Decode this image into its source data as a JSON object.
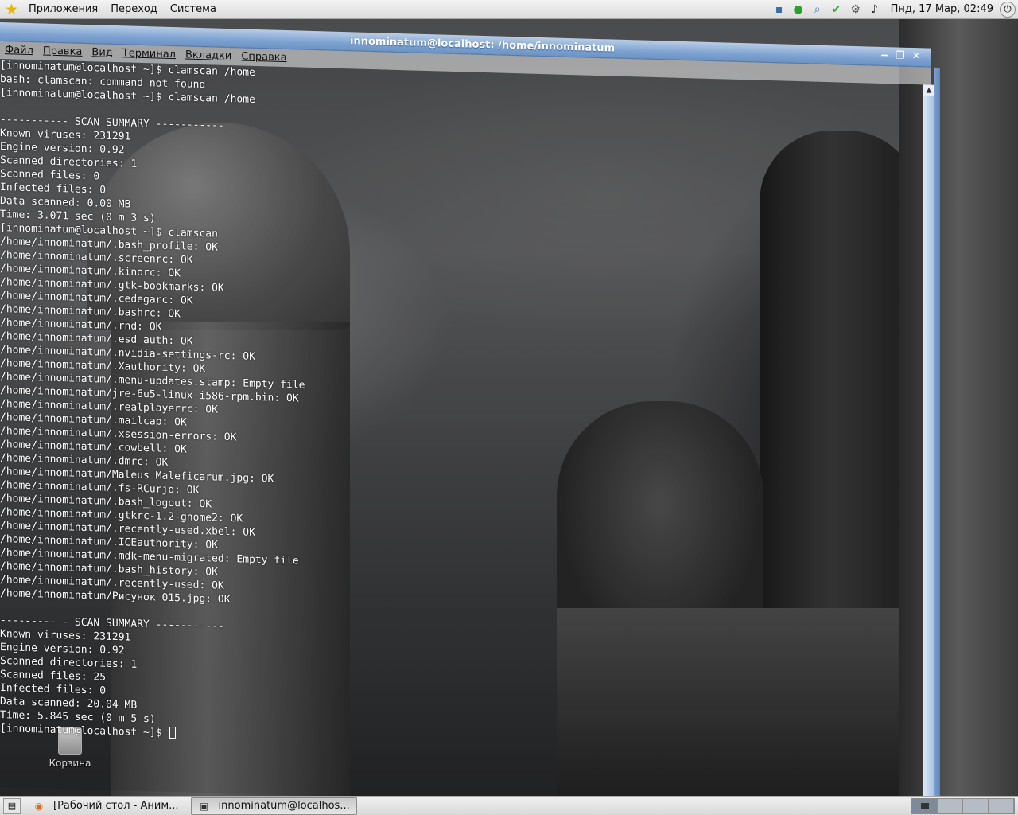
{
  "top_panel": {
    "menus": [
      "Приложения",
      "Переход",
      "Система"
    ],
    "clock": "Пнд, 17 Мар, 02:49",
    "tray_icons": [
      "network-icon",
      "green-status-icon",
      "search-icon",
      "update-check-icon",
      "network-tools-icon",
      "volume-icon"
    ]
  },
  "desktop": {
    "trash_label": "Корзина"
  },
  "terminal": {
    "title": "innominatum@localhost: /home/innominatum",
    "menu": [
      "Файл",
      "Правка",
      "Вид",
      "Терминал",
      "Вкладки",
      "Справка"
    ],
    "lines": [
      "[innominatum@localhost ~]$ clamscan /home",
      "bash: clamscan: command not found",
      "[innominatum@localhost ~]$ clamscan /home",
      "",
      "----------- SCAN SUMMARY -----------",
      "Known viruses: 231291",
      "Engine version: 0.92",
      "Scanned directories: 1",
      "Scanned files: 0",
      "Infected files: 0",
      "Data scanned: 0.00 MB",
      "Time: 3.071 sec (0 m 3 s)",
      "[innominatum@localhost ~]$ clamscan",
      "/home/innominatum/.bash_profile: OK",
      "/home/innominatum/.screenrc: OK",
      "/home/innominatum/.kinorc: OK",
      "/home/innominatum/.gtk-bookmarks: OK",
      "/home/innominatum/.cedegarc: OK",
      "/home/innominatum/.bashrc: OK",
      "/home/innominatum/.rnd: OK",
      "/home/innominatum/.esd_auth: OK",
      "/home/innominatum/.nvidia-settings-rc: OK",
      "/home/innominatum/.Xauthority: OK",
      "/home/innominatum/.menu-updates.stamp: Empty file",
      "/home/innominatum/jre-6u5-linux-i586-rpm.bin: OK",
      "/home/innominatum/.realplayerrc: OK",
      "/home/innominatum/.mailcap: OK",
      "/home/innominatum/.xsession-errors: OK",
      "/home/innominatum/.cowbell: OK",
      "/home/innominatum/.dmrc: OK",
      "/home/innominatum/Maleus Maleficarum.jpg: OK",
      "/home/innominatum/.fs-RCurjq: OK",
      "/home/innominatum/.bash_logout: OK",
      "/home/innominatum/.gtkrc-1.2-gnome2: OK",
      "/home/innominatum/.recently-used.xbel: OK",
      "/home/innominatum/.ICEauthority: OK",
      "/home/innominatum/.mdk-menu-migrated: Empty file",
      "/home/innominatum/.bash_history: OK",
      "/home/innominatum/.recently-used: OK",
      "/home/innominatum/Рисунок 015.jpg: OK",
      "",
      "----------- SCAN SUMMARY -----------",
      "Known viruses: 231291",
      "Engine version: 0.92",
      "Scanned directories: 1",
      "Scanned files: 25",
      "Infected files: 0",
      "Data scanned: 20.04 MB",
      "Time: 5.845 sec (0 m 5 s)"
    ],
    "prompt": "[innominatum@localhost ~]$ "
  },
  "taskbar": {
    "tasks": [
      {
        "label": "[Рабочий стол - Аним...",
        "icon": "firefox-icon",
        "active": false
      },
      {
        "label": "innominatum@localhos...",
        "icon": "terminal-icon",
        "active": true
      }
    ]
  },
  "colors": {
    "titlebar": "#7ea3d1",
    "panel": "#e6e6e6",
    "terminal_text": "#ffffff"
  }
}
